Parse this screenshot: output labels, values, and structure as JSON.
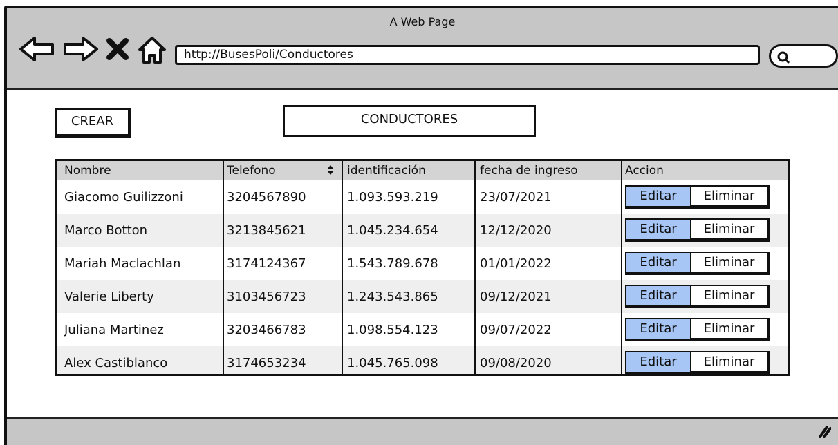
{
  "browser": {
    "title": "A Web Page",
    "url": "http://BusesPoli/Conductores",
    "icons": [
      "back-arrow-icon",
      "forward-arrow-icon",
      "close-icon",
      "home-icon",
      "search-icon"
    ]
  },
  "toolbar": {
    "create_label": "CREAR"
  },
  "page": {
    "title": "CONDUCTORES"
  },
  "table": {
    "columns": [
      "Nombre",
      "Telefono",
      "identificación",
      "fecha de ingreso",
      "Accion"
    ],
    "sort_icon": "sort-updown-icon",
    "rows": [
      {
        "nombre": "Giacomo Guilizzoni",
        "telefono": "3204567890",
        "identificacion": "1.093.593.219",
        "fecha": "23/07/2021",
        "edit": "Editar",
        "delete": "Eliminar"
      },
      {
        "nombre": "Marco Botton",
        "telefono": "3213845621",
        "identificacion": "1.045.234.654",
        "fecha": "12/12/2020",
        "edit": "Editar",
        "delete": "Eliminar"
      },
      {
        "nombre": "Mariah Maclachlan",
        "telefono": "3174124367",
        "identificacion": "1.543.789.678",
        "fecha": "01/01/2022",
        "edit": "Editar",
        "delete": "Eliminar"
      },
      {
        "nombre": "Valerie Liberty",
        "telefono": "3103456723",
        "identificacion": "1.243.543.865",
        "fecha": "09/12/2021",
        "edit": "Editar",
        "delete": "Eliminar"
      },
      {
        "nombre": "Juliana Martinez",
        "telefono": "3203466783",
        "identificacion": "1.098.554.123",
        "fecha": "09/07/2022",
        "edit": "Editar",
        "delete": "Eliminar"
      },
      {
        "nombre": "Alex Castiblanco",
        "telefono": "3174653234",
        "identificacion": "1.045.765.098",
        "fecha": "09/08/2020",
        "edit": "Editar",
        "delete": "Eliminar"
      }
    ]
  },
  "colors": {
    "chrome": "#c6c6c6",
    "edit_button": "#a7c6f5",
    "header_row": "#d4d4d4",
    "alt_row": "#efefef"
  }
}
